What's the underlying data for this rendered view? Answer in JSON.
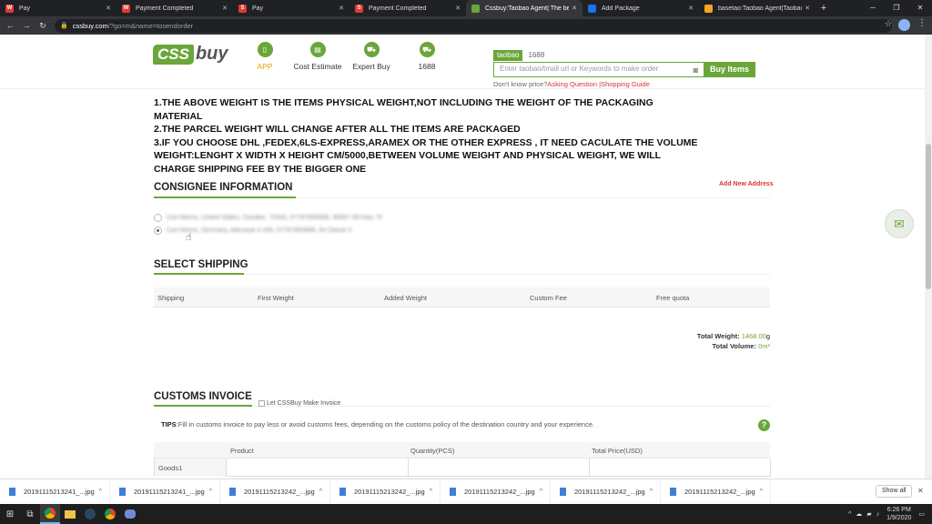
{
  "browser": {
    "tabs": [
      {
        "label": "Pay",
        "color": "#e53935",
        "fav": "W"
      },
      {
        "label": "Payment Completed",
        "color": "#e53935",
        "fav": "W"
      },
      {
        "label": "Pay",
        "color": "#e53935",
        "fav": "S"
      },
      {
        "label": "Payment Completed",
        "color": "#e53935",
        "fav": "S"
      },
      {
        "label": "Cssbuy:Taobao Agent| The best c",
        "color": "#6aa63a",
        "fav": ""
      },
      {
        "label": "Add Package",
        "color": "#1a73e8",
        "fav": ""
      },
      {
        "label": "basetao:Taobao Agent|Taobao Ex",
        "color": "#f5a623",
        "fav": ""
      }
    ],
    "url_host": "cssbuy.com",
    "url_path": "/?go=m&name=tosendorder"
  },
  "header": {
    "logo_left": "CSS",
    "logo_right": "buy",
    "nav": [
      {
        "label": "APP"
      },
      {
        "label": "Cost Estimate"
      },
      {
        "label": "Expert Buy"
      },
      {
        "label": "1688"
      }
    ],
    "search_tabs": [
      "taobao",
      "1688"
    ],
    "search_placeholder": "Enter taobao/tmall url or Keywords to make order",
    "search_button": "Buy Items",
    "help_prefix": "Don't know price?",
    "help_link1": "Asking Question",
    "help_sep": " |",
    "help_link2": "Shopping Guide"
  },
  "notes": [
    "1.THE ABOVE WEIGHT IS THE ITEMS PHYSICAL WEIGHT,NOT INCLUDING THE WEIGHT OF THE PACKAGING MATERIAL",
    "2.THE PARCEL WEIGHT WILL CHANGE AFTER ALL THE ITEMS ARE PACKAGED",
    "3.IF YOU CHOOSE DHL ,FEDEX,6LS-EXPRESS,ARAMEX OR THE OTHER EXPRESS , IT NEED CACULATE THE VOLUME WEIGHT:LENGHT X WIDTH X HEIGHT CM/5000,BETWEEN VOLUME WEIGHT AND PHYSICAL WEIGHT, WE WILL CHARGE SHIPPING FEE BY THE BIGGER ONE"
  ],
  "consignee": {
    "title": "CONSIGNEE INFORMATION",
    "add_new": "Add New Address",
    "addresses": [
      {
        "text": "Carl Morris, United States, Dundee, 75342, 07787893986, 95847 IM Hwy 75",
        "selected": false
      },
      {
        "text": "Carl Morris, Germany, Altenaue 4 445, 07787893986, An Dasse 5",
        "selected": true
      }
    ]
  },
  "shipping": {
    "title": "SELECT SHIPPING",
    "columns": [
      "Shipping",
      "First Weight",
      "Added Weight",
      "Custom Fee",
      "Free quota"
    ],
    "total_weight_label": "Total Weight:",
    "total_weight_value": "1468.00",
    "total_weight_unit": "g",
    "total_volume_label": "Total Volume:",
    "total_volume_value": "0m³"
  },
  "customs": {
    "title": "CUSTOMS INVOICE",
    "let_label": "Let CSSBuy Make Invoice",
    "tips_label": "TIPS",
    "tips_text": ":Fill in customs invoice to pay less or avoid customs fees, depending on the customs policy of the destination country and your experience.",
    "columns": [
      "Product",
      "Quantity(PCS)",
      "Total Price(USD)"
    ],
    "row_label": "Goods1"
  },
  "downloads": {
    "items": [
      "20191115213241_...jpg",
      "20191115213241_...jpg",
      "20191115213242_...jpg",
      "20191115213242_...jpg",
      "20191115213242_...jpg",
      "20191115213242_...jpg",
      "20191115213242_...jpg"
    ],
    "show_all": "Show all"
  },
  "taskbar": {
    "time": "6:26 PM",
    "date": "1/9/2020"
  }
}
